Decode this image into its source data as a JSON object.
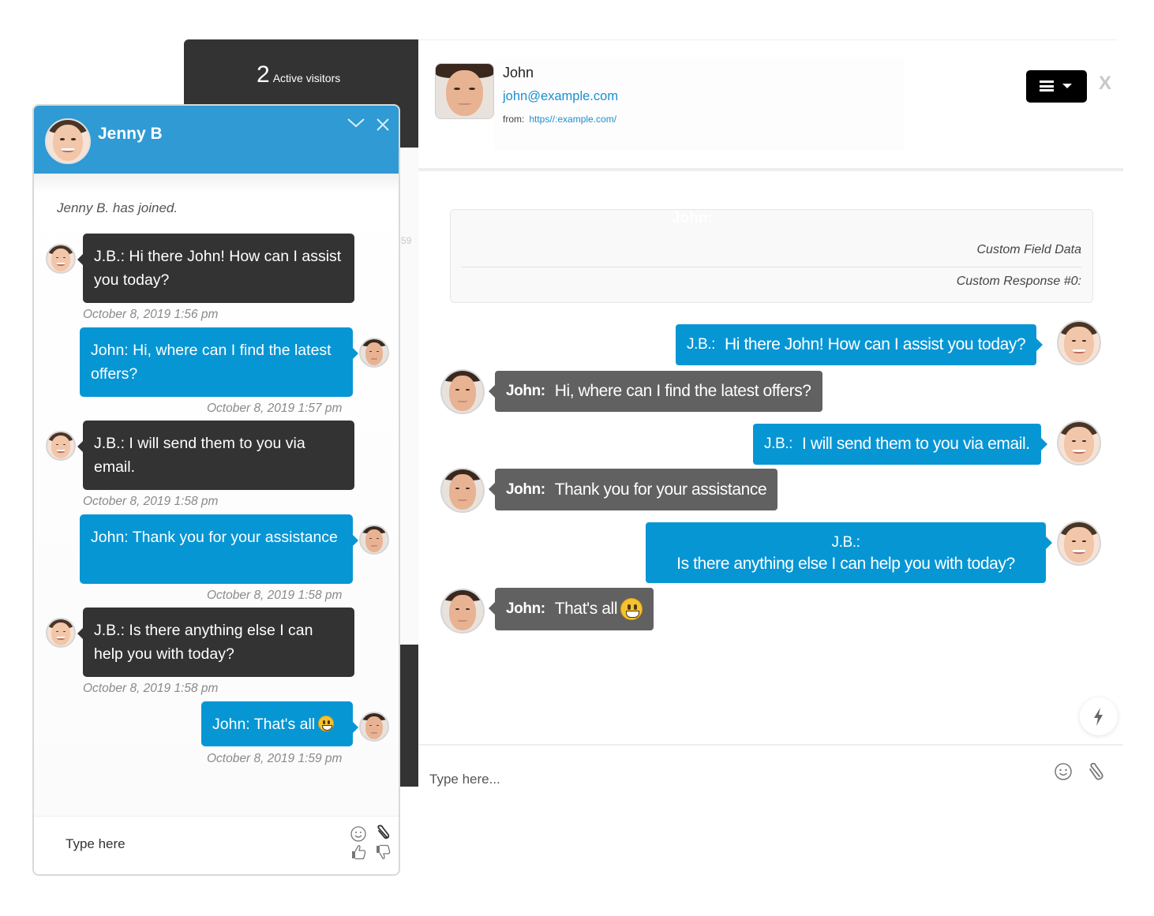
{
  "visitors_panel": {
    "count": "2",
    "label": "Active visitors",
    "ghost_time": "59"
  },
  "widget": {
    "agent_name": "Jenny B",
    "joined_notice": "Jenny B. has joined.",
    "input_placeholder": "Type here",
    "icons": [
      "chevron-down-icon",
      "close-icon",
      "smiley-icon",
      "paperclip-icon",
      "thumbs-up-icon",
      "thumbs-down-icon"
    ],
    "messages": [
      {
        "side": "agent",
        "text": "J.B.:  Hi there John! How can I assist you today?",
        "timestamp": "October 8, 2019 1:56 pm"
      },
      {
        "side": "visitor",
        "text": "John: Hi, where can I find the latest offers?",
        "timestamp": "October 8, 2019 1:57 pm"
      },
      {
        "side": "agent",
        "text": "J.B.:  I will send them to you via email.",
        "timestamp": "October 8, 2019 1:58 pm"
      },
      {
        "side": "visitor",
        "text": "John: Thank you for your assistance",
        "timestamp": "October 8, 2019 1:58 pm"
      },
      {
        "side": "agent",
        "text": "J.B.:  Is there anything else I can help you with today?",
        "timestamp": "October 8, 2019 1:58 pm"
      },
      {
        "side": "visitor",
        "text": "John: That's all",
        "emoji": "grinning-face",
        "timestamp": "October 8, 2019 1:59 pm"
      }
    ]
  },
  "console": {
    "visitor": {
      "name": "John",
      "email": "john@example.com",
      "from_label": "from:",
      "from_url": "https//:example.com/"
    },
    "menu_button": "menu-icon",
    "close_label": "X",
    "custom": {
      "ghost_label": "John:",
      "field_title": "Custom Field Data",
      "response_label": "Custom Response #0:"
    },
    "messages": [
      {
        "side": "agent",
        "sender": "J.B.:",
        "text": "Hi there John! How can I assist you today?"
      },
      {
        "side": "visitor",
        "sender": "John:",
        "text": "Hi, where can I find the latest offers?"
      },
      {
        "side": "agent",
        "sender": "J.B.:",
        "text": "I will send them to you via email."
      },
      {
        "side": "visitor",
        "sender": "John:",
        "text": "Thank you for your assistance"
      },
      {
        "side": "agent",
        "sender": "J.B.:",
        "text": "Is there anything else I can help you with today?"
      },
      {
        "side": "visitor",
        "sender": "John:",
        "text": "That's all",
        "emoji": "grinning-face"
      }
    ],
    "input_placeholder": "Type here...",
    "colors": {
      "agent_bubble": "#0796d4",
      "visitor_bubble": "#616161",
      "widget_header": "#2f9ad3",
      "widget_agent_bubble": "#333333"
    }
  }
}
